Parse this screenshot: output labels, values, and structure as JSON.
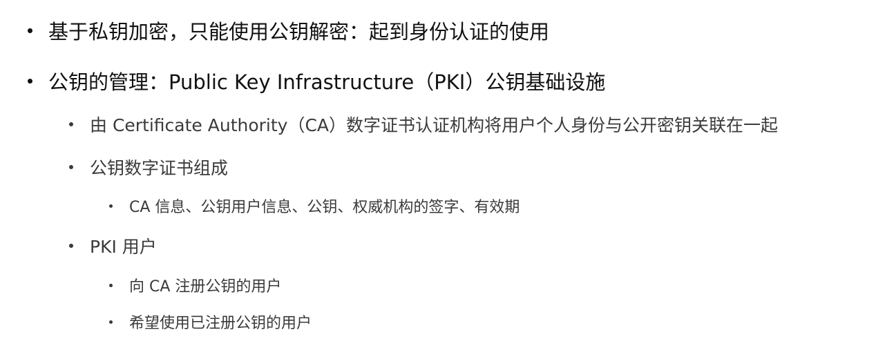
{
  "bullets": [
    {
      "level": 1,
      "text": "基于私钥加密，只能使用公钥解密：起到身份认证的使用"
    },
    {
      "level": 1,
      "text": "公钥的管理：Public Key Infrastructure（PKI）公钥基础设施"
    },
    {
      "level": 2,
      "text": "由 Certificate Authority（CA）数字证书认证机构将用户个人身份与公开密钥关联在一起"
    },
    {
      "level": 2,
      "text": "公钥数字证书组成"
    },
    {
      "level": 3,
      "text": "CA 信息、公钥用户信息、公钥、权威机构的签字、有效期"
    },
    {
      "level": 2,
      "text": "PKI 用户"
    },
    {
      "level": 3,
      "text": "向 CA 注册公钥的用户"
    },
    {
      "level": 3,
      "text": "希望使用已注册公钥的用户"
    }
  ],
  "colors": {
    "level1_text": "#111111",
    "level2_text": "#3a3a3a",
    "background": "#ffffff"
  }
}
